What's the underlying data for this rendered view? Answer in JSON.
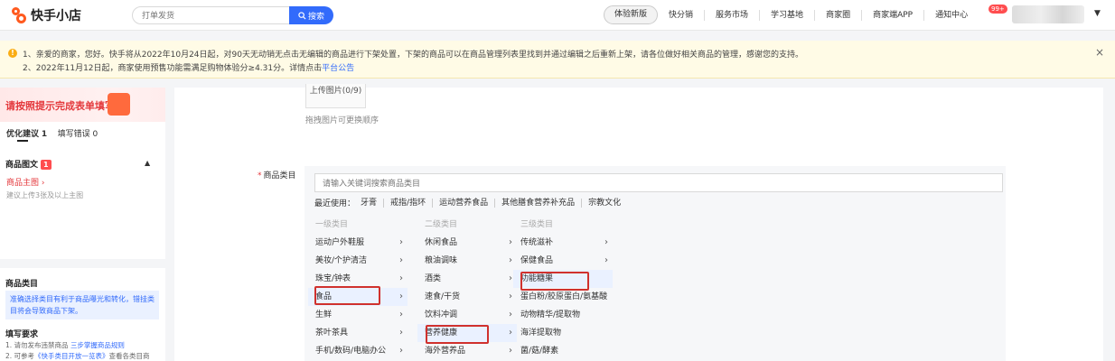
{
  "brand": {
    "name": "快手小店"
  },
  "search": {
    "placeholder": "打单发货",
    "button": "搜索"
  },
  "nav": {
    "pill": "体验新版",
    "items": [
      "快分销",
      "服务市场",
      "学习基地",
      "商家圈",
      "商家端APP",
      "通知中心"
    ],
    "badge": "99+"
  },
  "notice": {
    "line1": "1、亲爱的商家，您好。快手将从2022年10月24日起，对90天无动销无点击无编辑的商品进行下架处置，下架的商品可以在商品管理列表里找到并通过编辑之后重新上架，请各位做好相关商品的管理，感谢您的支持。",
    "line2_prefix": "2、2022年11月12日起，商家使用预售功能需满足购物体验分≥4.31分。详情点击",
    "line2_link": "平台公告",
    "close": "×"
  },
  "left": {
    "banner": "请按照提示完成表单填写",
    "opt_label": "优化建议",
    "opt_count": "1",
    "err_label": "填写错误",
    "err_count": "0",
    "section_title": "商品图文",
    "section_badge": "1",
    "main_image": "商品主图",
    "main_image_hint": "建议上传3张及以上主图",
    "cat_title": "商品类目",
    "cat_tip": "准确选择类目有利于商品曝光和转化，错挂类目将会导致商品下架。",
    "req_title": "填写要求",
    "req_line1_prefix": "1. 请勿发布违禁商品",
    "req_line1_link": "三步掌握商品规则",
    "req_line2_prefix": "2. 可参考",
    "req_line2_link": "《快手类目开放一览表》",
    "req_line2_suffix": "查看各类目商"
  },
  "main": {
    "upload_label": "上传图片(0/9)",
    "upload_hint": "拖拽图片可更换顺序",
    "cat_label": "商品类目",
    "cat_placeholder": "请输入关键词搜索商品类目",
    "recent_label": "最近使用：",
    "recent": [
      "牙膏",
      "戒指/指环",
      "运动营养食品",
      "其他膳食营养补充品",
      "宗教文化"
    ],
    "col1_head": "一级类目",
    "col2_head": "二级类目",
    "col3_head": "三级类目",
    "col1": [
      "运动户外鞋服",
      "美妆/个护清洁",
      "珠宝/钟表",
      "食品",
      "生鲜",
      "茶叶茶具",
      "手机/数码/电脑办公"
    ],
    "col2": [
      "休闲食品",
      "粮油调味",
      "酒类",
      "速食/干货",
      "饮料冲调",
      "营养健康",
      "海外营养品"
    ],
    "col3": [
      "传统滋补",
      "保健食品",
      "功能糖果",
      "蛋白粉/胶原蛋白/氨基酸",
      "动物精华/提取物",
      "海洋提取物",
      "菌/菇/酵素"
    ]
  },
  "colors": {
    "accent": "#326bfb",
    "highlight": "#d0312d",
    "brand": "#ff5a1f"
  }
}
